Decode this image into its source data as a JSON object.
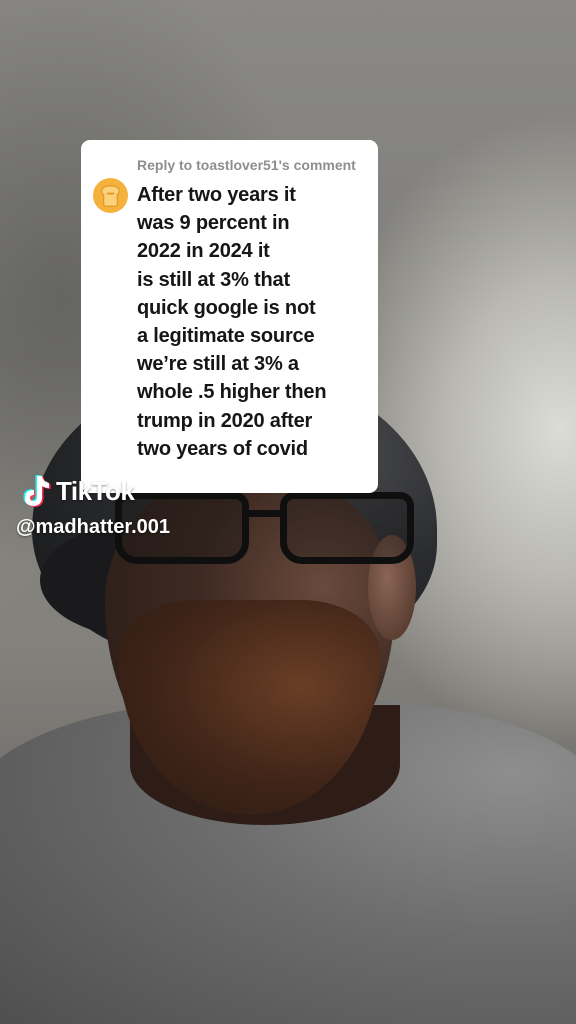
{
  "comment_reply": {
    "reply_prefix": "Reply to toastlover51's comment",
    "text": "After two years it\nwas 9 percent in\n2022 in 2024 it\nis still at 3% that\nquick google is not\na legitimate source\nwe’re still at 3% a\nwhole .5 higher then\ntrump in 2020 after\ntwo years of covid",
    "avatar_icon": "toast-avatar-icon",
    "avatar_color": "#f4b23c"
  },
  "watermark": {
    "brand": "TikTok",
    "username": "@madhatter.001",
    "logo_icon": "tiktok-note-icon"
  }
}
